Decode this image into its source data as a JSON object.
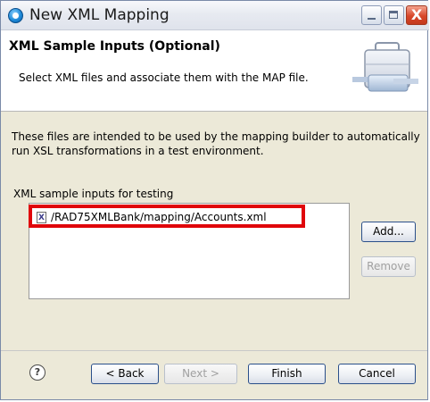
{
  "window": {
    "title": "New XML Mapping"
  },
  "header": {
    "title": "XML Sample Inputs (Optional)",
    "description": "Select XML files and associate them with the MAP file."
  },
  "intro_text": "These files are intended to be used by the mapping builder to automatically run XSL transformations in a test environment.",
  "list": {
    "label": "XML sample inputs for testing",
    "items": [
      {
        "icon": "xml-file-icon",
        "path": "/RAD75XMLBank/mapping/Accounts.xml"
      }
    ]
  },
  "buttons": {
    "add": "Add...",
    "remove": "Remove",
    "back": "< Back",
    "next": "Next >",
    "finish": "Finish",
    "cancel": "Cancel",
    "help": "?"
  },
  "xml_icon_letter": "X",
  "close_glyph": "X",
  "colors": {
    "highlight": "#e0060a",
    "titlebar": "#e7eaf1",
    "dialog_bg": "#ece9d8"
  }
}
